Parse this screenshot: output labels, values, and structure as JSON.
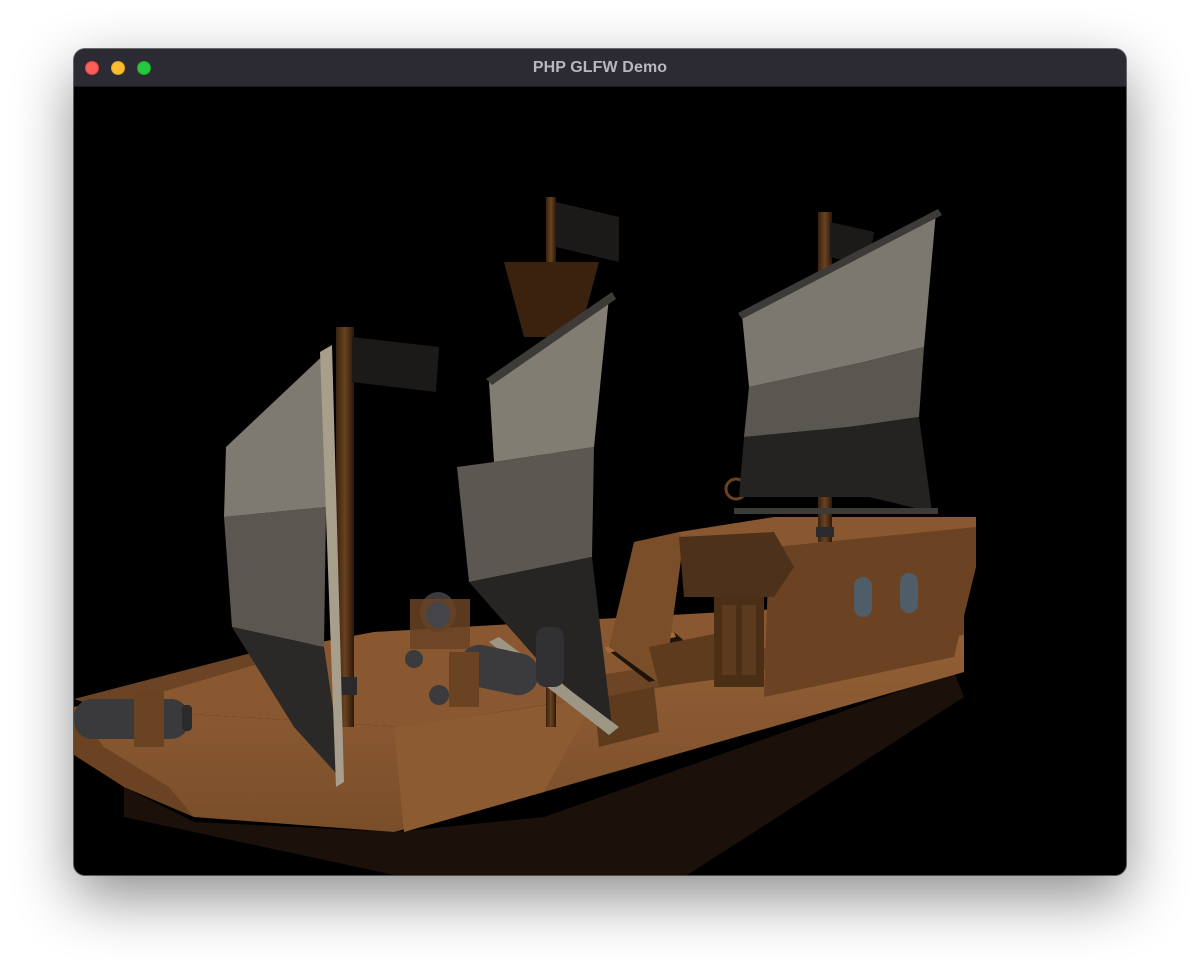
{
  "window": {
    "title": "PHP GLFW Demo",
    "controls": {
      "close_color": "#fe5f57",
      "minimize_color": "#febc2e",
      "zoom_color": "#28c840"
    }
  },
  "scene": {
    "background_color": "#000000",
    "subject": "3d-pirate-ship",
    "palette": {
      "hull": "#8a5a32",
      "hull_dark": "#5c3a1e",
      "hull_shadow": "#1c110a",
      "sail_light": "#7a756c",
      "sail_dark": "#2b2a28",
      "mast": "#5a3619",
      "cannon": "#3a3a3c",
      "flag": "#1b1a19"
    }
  }
}
